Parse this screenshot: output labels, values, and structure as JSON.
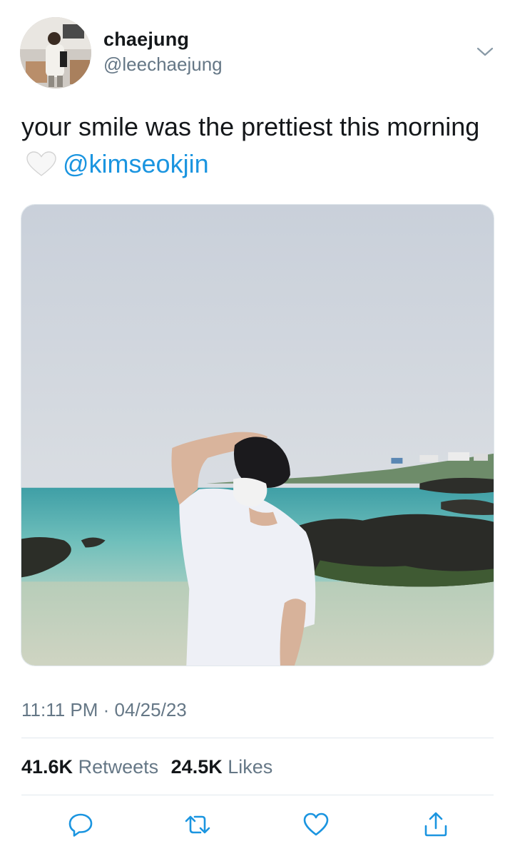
{
  "tweet": {
    "author": {
      "display_name": "chaejung",
      "handle": "@leechaejung"
    },
    "text_line": "your smile was the prettiest this morning",
    "emoji": "white-heart",
    "mention": "@kimseokjin",
    "timestamp": "11:11 PM · 04/25/23",
    "stats": {
      "retweets_count": "41.6K",
      "retweets_label": "Retweets",
      "likes_count": "24.5K",
      "likes_label": "Likes"
    }
  },
  "icons": {
    "menu": "chevron-down-icon",
    "reply": "reply-icon",
    "retweet": "retweet-icon",
    "like": "heart-icon",
    "share": "share-icon"
  },
  "colors": {
    "text_primary": "#14171a",
    "text_secondary": "#657786",
    "link": "#1b95e0",
    "divider": "#e1e8ed"
  }
}
